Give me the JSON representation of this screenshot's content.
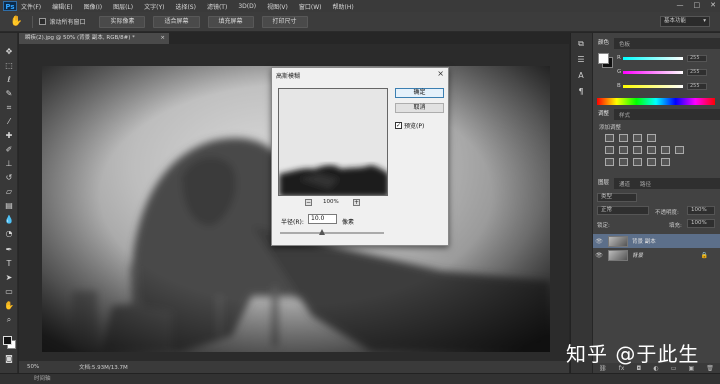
{
  "menubar": {
    "logo": "Ps",
    "items": [
      "文件(F)",
      "编辑(E)",
      "图像(I)",
      "图层(L)",
      "文字(Y)",
      "选择(S)",
      "滤镜(T)",
      "3D(D)",
      "视图(V)",
      "窗口(W)",
      "帮助(H)"
    ],
    "minimize": "—",
    "maximize": "□",
    "close": "✕"
  },
  "options": {
    "scroll_all_label": "滚动所有窗口",
    "buttons": [
      "实际像素",
      "适合屏幕",
      "填充屏幕",
      "打印尺寸"
    ],
    "workspace": "基本功能"
  },
  "document": {
    "tab_title": "瞬疾(2).jpg @ 50% (背景 副本, RGB/8#) *",
    "zoom": "50%",
    "doc_size": "文档:5.93M/13.7M"
  },
  "timeline": {
    "label": "时间轴"
  },
  "color_panel": {
    "tabs": [
      "颜色",
      "色板"
    ],
    "channels": [
      {
        "name": "R",
        "value": "255",
        "color": "#ff3333"
      },
      {
        "name": "G",
        "value": "255",
        "color": "#33dd33"
      },
      {
        "name": "B",
        "value": "255",
        "color": "#3366ff"
      }
    ]
  },
  "adjust_panel": {
    "tabs": [
      "调整",
      "样式"
    ],
    "title": "添加调整"
  },
  "layers_panel": {
    "tabs": [
      "图层",
      "通道",
      "路径"
    ],
    "kind_filter": "类型",
    "blend_mode": "正常",
    "opacity_label": "不透明度:",
    "opacity": "100%",
    "lock_label": "锁定:",
    "fill_label": "填充:",
    "fill": "100%",
    "layers": [
      {
        "name": "背景 副本",
        "locked": false
      },
      {
        "name": "背景",
        "locked": true
      }
    ]
  },
  "dialog": {
    "title": "高斯模糊",
    "ok": "确定",
    "cancel": "取消",
    "preview_label": "预览(P)",
    "preview_checked": "✓",
    "preview_zoom": "100%",
    "zoom_minus": "−",
    "zoom_plus": "+",
    "radius_label": "半径(R):",
    "radius_value": "10.0",
    "radius_unit": "像素"
  },
  "watermark": "知乎 @于此生"
}
